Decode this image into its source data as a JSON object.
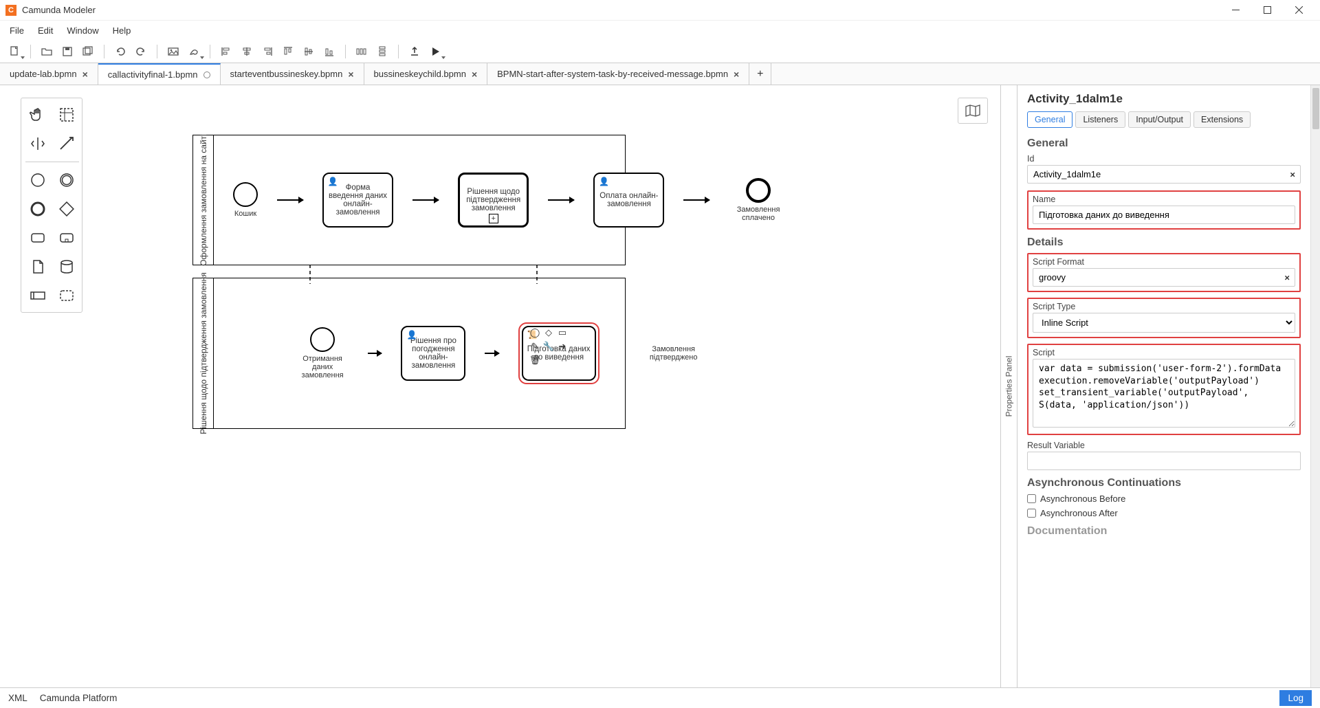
{
  "app": {
    "title": "Camunda Modeler"
  },
  "menu": {
    "file": "File",
    "edit": "Edit",
    "window": "Window",
    "help": "Help"
  },
  "tabs": [
    {
      "label": "update-lab.bpmn",
      "dirty": false,
      "active": false
    },
    {
      "label": "callactivityfinal-1.bpmn",
      "dirty": true,
      "active": true
    },
    {
      "label": "starteventbussineskey.bpmn",
      "dirty": false,
      "active": false
    },
    {
      "label": "bussineskeychild.bpmn",
      "dirty": false,
      "active": false
    },
    {
      "label": "BPMN-start-after-system-task-by-received-message.bpmn",
      "dirty": false,
      "active": false
    }
  ],
  "pools": {
    "top": {
      "label": "Оформлення замовлення на сайті",
      "start_label": "Кошик",
      "task1": "Форма введення даних онлайн-замовлення",
      "task2": "Рішення щодо підтвердження замовлення",
      "task3": "Оплата онлайн-замовлення",
      "end_label": "Замовлення сплачено"
    },
    "bottom": {
      "label": "Рішення щодо підтвердження замовлення",
      "start_label": "Отримання даних замовлення",
      "task1": "Рішення про погодження онлайн-замовлення",
      "task2": "Підготовка даних до виведення",
      "end_label": "Замовлення підтверджено"
    }
  },
  "props": {
    "element_id_heading": "Activity_1dalm1e",
    "tabs": {
      "general": "General",
      "listeners": "Listeners",
      "io": "Input/Output",
      "ext": "Extensions"
    },
    "general_h": "General",
    "id_label": "Id",
    "id_value": "Activity_1dalm1e",
    "name_label": "Name",
    "name_value": "Підготовка даних до виведення",
    "details_h": "Details",
    "script_format_label": "Script Format",
    "script_format_value": "groovy",
    "script_type_label": "Script Type",
    "script_type_value": "Inline Script",
    "script_label": "Script",
    "script_value": "var data = submission('user-form-2').formData\nexecution.removeVariable('outputPayload')\nset_transient_variable('outputPayload', S(data, 'application/json'))",
    "result_var_label": "Result Variable",
    "result_var_value": "",
    "async_h": "Asynchronous Continuations",
    "async_before": "Asynchronous Before",
    "async_after": "Asynchronous After",
    "doc_h": "Documentation"
  },
  "status": {
    "xml": "XML",
    "platform": "Camunda Platform",
    "log": "Log"
  },
  "side_panel_label": "Properties Panel"
}
